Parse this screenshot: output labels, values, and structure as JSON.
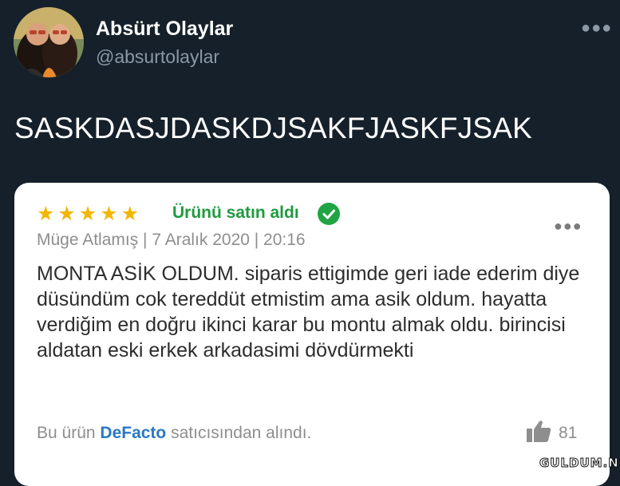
{
  "tweet": {
    "author_name": "Absürt Olaylar",
    "handle": "@absurtolaylar",
    "more_icon": "more-horizontal-icon",
    "text": "SASKDASJDASKDJSAKFJASKFJSAK"
  },
  "review_card": {
    "rating": 5,
    "stars": "★★★★★",
    "purchased_label": "Ürünü satın aldı",
    "purchased_icon": "check-circle-icon",
    "meta": "Müge Atlamış | 7 Aralık 2020 | 20:16",
    "body": "MONTA ASİK OLDUM. siparis ettigimde geri iade ederim diye düsündüm cok tereddüt etmistim ama asik oldum. hayatta verdiğim en doğru ikinci karar bu montu almak oldu. birincisi aldatan eski erkek arkadasimi dövdürmekti",
    "footer_prefix": "Bu ürün",
    "seller": "DeFacto",
    "footer_suffix": "satıcısından alındı.",
    "like_icon": "thumbs-up-icon",
    "likes": "81"
  },
  "watermark": "GULDUM.NET",
  "colors": {
    "background": "#15202b",
    "star": "#f2b705",
    "purchased": "#1f9b3e",
    "seller": "#2b78c5"
  }
}
